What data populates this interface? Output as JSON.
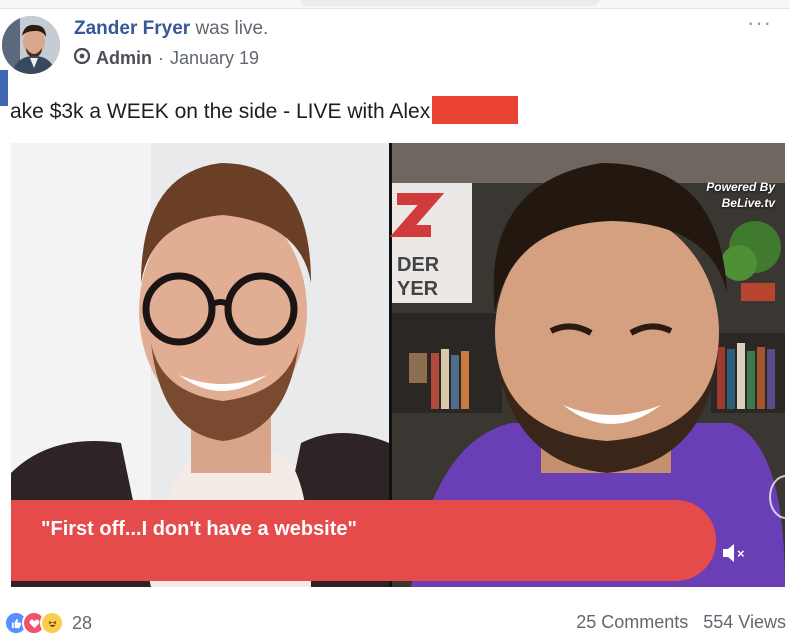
{
  "post": {
    "author_name": "Zander Fryer",
    "action_text": "was live.",
    "role_label": "Admin",
    "separator": "·",
    "date": "January 19",
    "more_label": "···",
    "title_text": "ake $3k a WEEK on the side - LIVE with Alex"
  },
  "video": {
    "powered_line1": "Powered By",
    "powered_line2": "BeLive.tv",
    "caption": "\"First off...I don't have a website\"",
    "backdrop_sign_line1": "DER",
    "backdrop_sign_line2": "YER",
    "backdrop_logo": "Z",
    "mute_x": "×"
  },
  "footer": {
    "reaction_count": "28",
    "comments": "25 Comments",
    "views": "554 Views"
  },
  "colors": {
    "caption_red": "#e54b4b",
    "link_blue": "#365899",
    "redaction_red": "#ea4335",
    "purple_shirt": "#6a3fb5"
  }
}
